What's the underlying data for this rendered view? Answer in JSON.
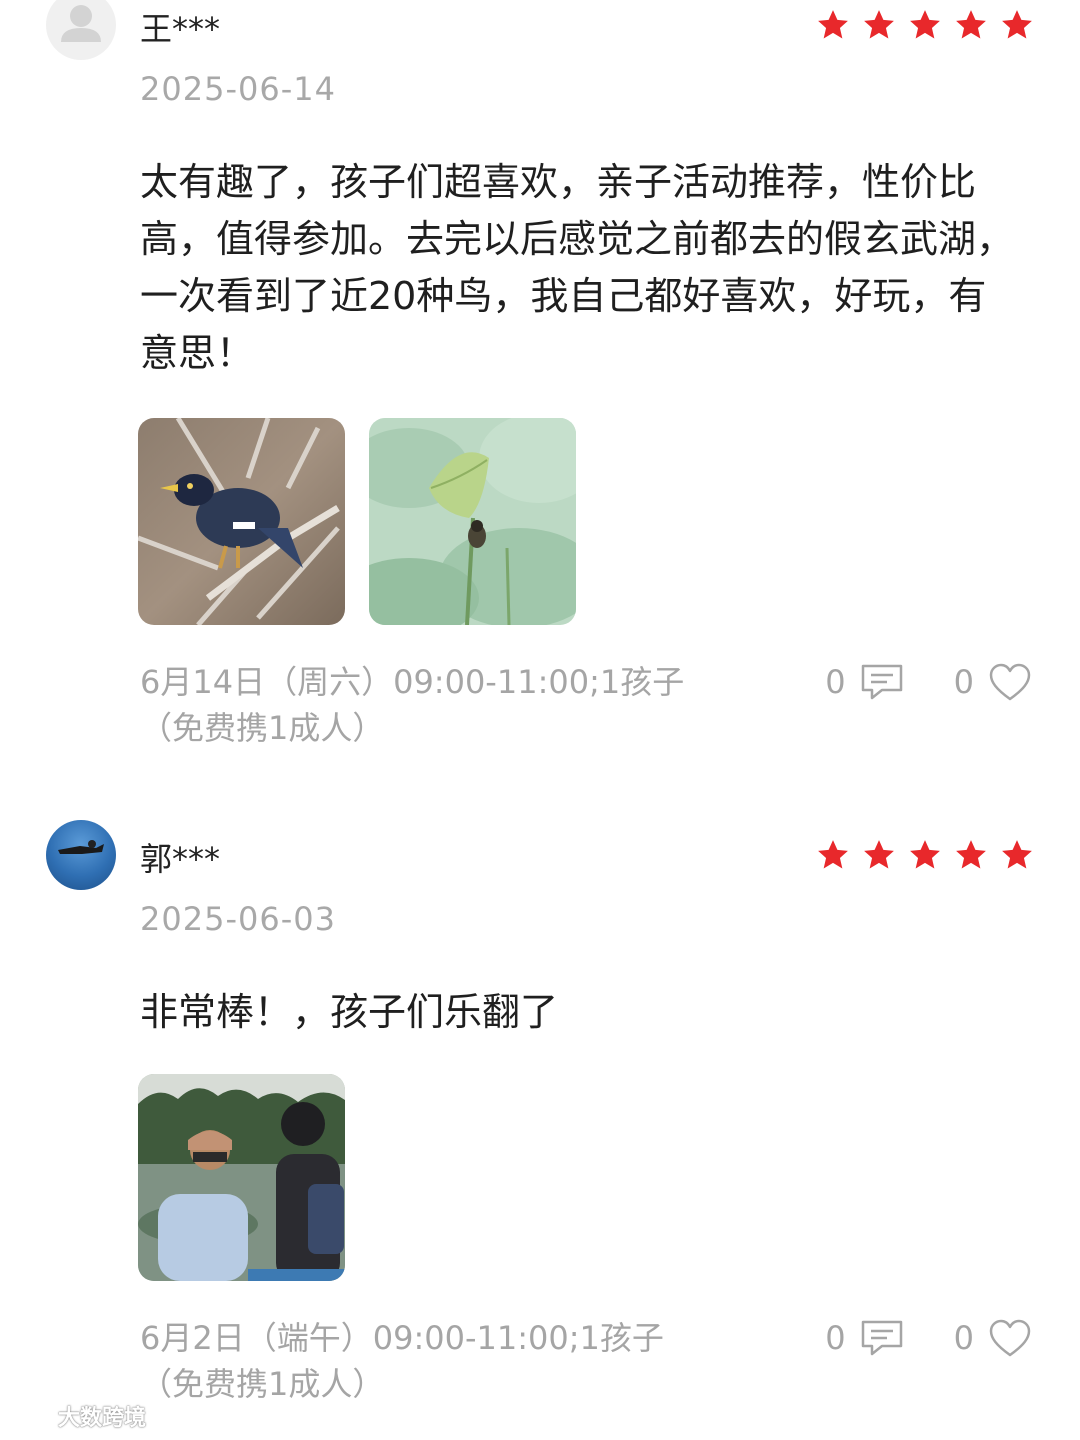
{
  "colors": {
    "star": "#e8282b",
    "muted": "#a8a8a8",
    "text": "#1f1f1f"
  },
  "reviews": [
    {
      "username": "王***",
      "rating": 5,
      "date": "2025-06-14",
      "content": "太有趣了，孩子们超喜欢，亲子活动推荐，性价比高，值得参加。去完以后感觉之前都去的假玄武湖，一次看到了近20种鸟，我自己都好喜欢，好玩，有意思！",
      "photos": [
        "bird-on-branch-photo",
        "lotus-with-small-bird-photo"
      ],
      "session": "6月14日（周六）09:00-11:00;1孩子（免费携1成人）",
      "comment_count": "0",
      "like_count": "0"
    },
    {
      "username": "郭***",
      "rating": 5,
      "date": "2025-06-03",
      "content": "非常棒！，孩子们乐翻了",
      "photos": [
        "birdwatchers-by-lake-photo"
      ],
      "session": "6月2日（端午）09:00-11:00;1孩子（免费携1成人）",
      "comment_count": "0",
      "like_count": "0"
    }
  ],
  "icons": {
    "comment": "comment-icon",
    "like": "heart-icon",
    "star": "star-icon"
  },
  "watermark": "大数跨境"
}
